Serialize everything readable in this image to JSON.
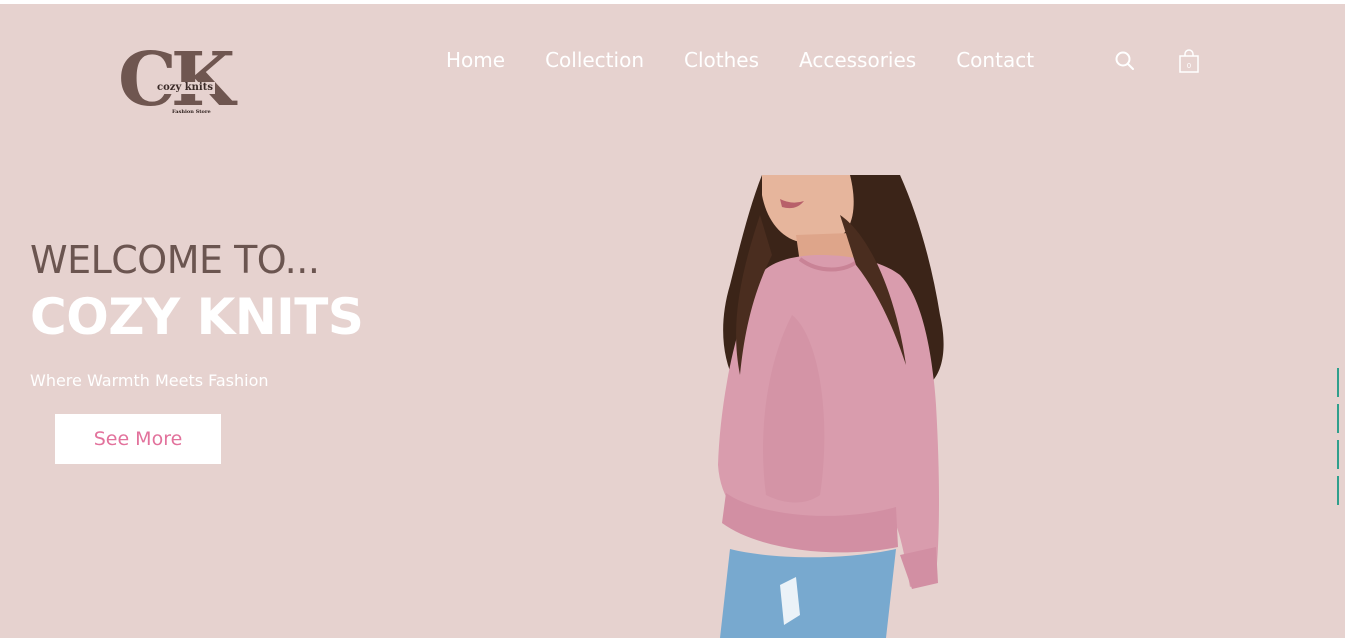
{
  "logo": {
    "mark": "CK",
    "name": "cozy knits",
    "tagline": "Fashion Store"
  },
  "nav": {
    "items": [
      {
        "label": "Home"
      },
      {
        "label": "Collection"
      },
      {
        "label": "Clothes"
      },
      {
        "label": "Accessories"
      },
      {
        "label": "Contact"
      }
    ],
    "search_icon": "search-icon",
    "cart_icon": "shopping-bag-icon",
    "cart_count": "0"
  },
  "hero": {
    "welcome": "WELCOME TO...",
    "brand": "COZY KNITS",
    "tagline": "Where Warmth Meets Fashion",
    "cta": "See More",
    "image": "model-in-pink-sweater"
  },
  "colors": {
    "background": "#e6d2cf",
    "logo": "#6f5650",
    "accent": "#e2729c",
    "indicator": "#2f9f8c"
  }
}
